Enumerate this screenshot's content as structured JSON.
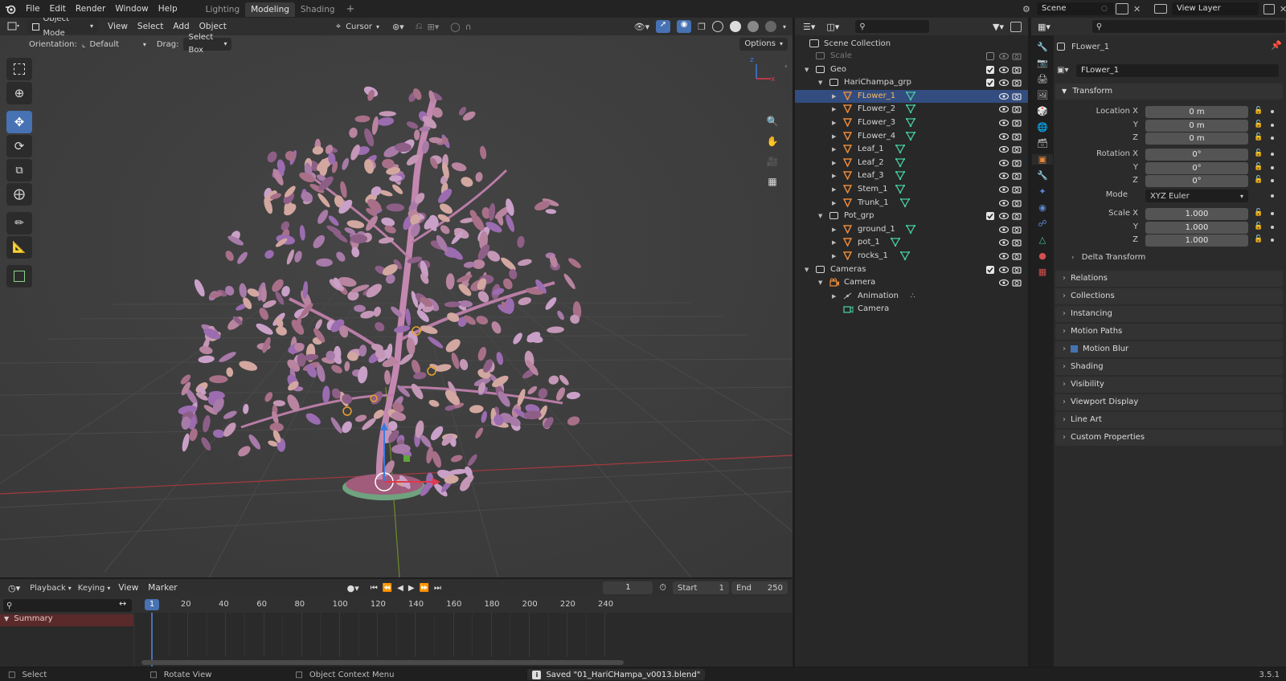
{
  "topbar": {
    "menus": [
      "File",
      "Edit",
      "Render",
      "Window",
      "Help"
    ],
    "workspaces": [
      "Lighting",
      "Modeling",
      "Shading"
    ],
    "active_workspace": "Modeling",
    "add_workspace": "+",
    "scene": "Scene",
    "view_layer": "View Layer"
  },
  "viewport": {
    "mode": "Object Mode",
    "menus": [
      "View",
      "Select",
      "Add",
      "Object"
    ],
    "pivot": "Cursor",
    "orientation_label": "Orientation:",
    "orientation_value": "Default",
    "drag_label": "Drag:",
    "drag_value": "Select Box",
    "options_label": "Options",
    "axis_z": "z",
    "axis_x": "x"
  },
  "timeline": {
    "menus": [
      "Playback",
      "Keying",
      "View",
      "Marker"
    ],
    "current_frame": "1",
    "start_label": "Start",
    "start_value": "1",
    "end_label": "End",
    "end_value": "250",
    "frame_marker": "1",
    "ticks": [
      "20",
      "40",
      "60",
      "80",
      "100",
      "120",
      "140",
      "160",
      "180",
      "200",
      "220",
      "240"
    ],
    "summary_label": "Summary"
  },
  "outliner": {
    "scene_collection": "Scene Collection",
    "rows": [
      {
        "label": "Scale",
        "kind": "collection",
        "indent": 0,
        "muted": true
      },
      {
        "label": "Geo",
        "kind": "collection",
        "indent": 0,
        "expanded": true
      },
      {
        "label": "HariChampa_grp",
        "kind": "collection",
        "indent": 1,
        "expanded": true
      },
      {
        "label": "FLower_1",
        "kind": "mesh",
        "indent": 2,
        "selected": true
      },
      {
        "label": "FLower_2",
        "kind": "mesh",
        "indent": 2
      },
      {
        "label": "FLower_3",
        "kind": "mesh",
        "indent": 2
      },
      {
        "label": "FLower_4",
        "kind": "mesh",
        "indent": 2
      },
      {
        "label": "Leaf_1",
        "kind": "mesh",
        "indent": 2
      },
      {
        "label": "Leaf_2",
        "kind": "mesh",
        "indent": 2
      },
      {
        "label": "Leaf_3",
        "kind": "mesh",
        "indent": 2
      },
      {
        "label": "Stem_1",
        "kind": "mesh",
        "indent": 2
      },
      {
        "label": "Trunk_1",
        "kind": "mesh",
        "indent": 2
      },
      {
        "label": "Pot_grp",
        "kind": "collection",
        "indent": 1,
        "expanded": true
      },
      {
        "label": "ground_1",
        "kind": "mesh",
        "indent": 2
      },
      {
        "label": "pot_1",
        "kind": "mesh",
        "indent": 2
      },
      {
        "label": "rocks_1",
        "kind": "mesh",
        "indent": 2
      },
      {
        "label": "Cameras",
        "kind": "collection",
        "indent": 0,
        "expanded": true
      },
      {
        "label": "Camera",
        "kind": "camera",
        "indent": 1,
        "expanded": true
      },
      {
        "label": "Animation",
        "kind": "animation",
        "indent": 2
      },
      {
        "label": "Camera",
        "kind": "cameradata",
        "indent": 2
      }
    ]
  },
  "properties": {
    "object_name": "FLower_1",
    "data_name": "FLower_1",
    "transform_header": "Transform",
    "location_label": "Location X",
    "rotation_label": "Rotation X",
    "scale_label": "Scale X",
    "y_label": "Y",
    "z_label": "Z",
    "location": [
      "0 m",
      "0 m",
      "0 m"
    ],
    "rotation": [
      "0°",
      "0°",
      "0°"
    ],
    "mode_label": "Mode",
    "mode_value": "XYZ Euler",
    "scale": [
      "1.000",
      "1.000",
      "1.000"
    ],
    "delta_transform": "Delta Transform",
    "panels": [
      "Relations",
      "Collections",
      "Instancing",
      "Motion Paths",
      "Motion Blur",
      "Shading",
      "Visibility",
      "Viewport Display",
      "Line Art",
      "Custom Properties"
    ]
  },
  "statusbar": {
    "select": "Select",
    "rotate": "Rotate View",
    "context": "Object Context Menu",
    "saved": "Saved \"01_HariCHampa_v0013.blend\"",
    "version": "3.5.1"
  },
  "colors": {
    "accent": "#4772b3",
    "selected_row": "#334d80",
    "mesh_icon": "#e8893a",
    "data_icon": "#46c9a0",
    "summary_bg": "#5a2a2a"
  }
}
